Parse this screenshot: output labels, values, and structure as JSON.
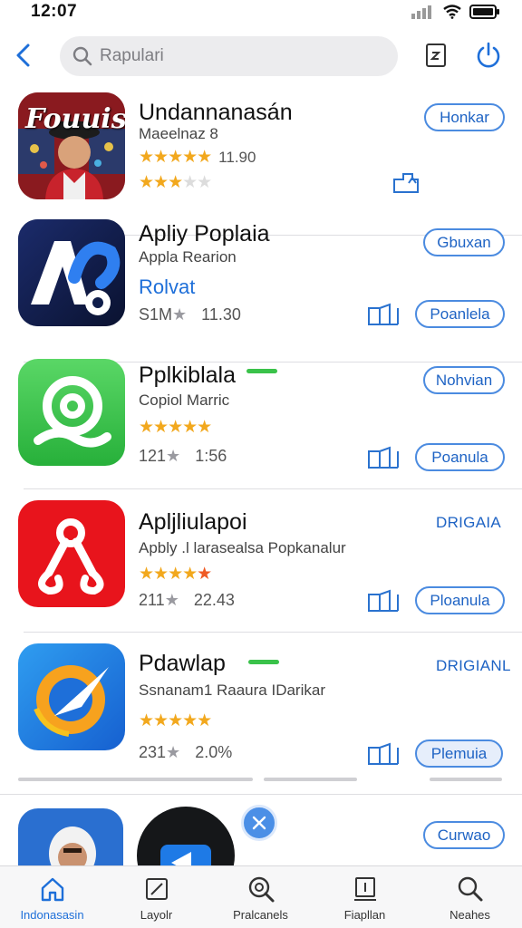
{
  "status": {
    "time": "12:07"
  },
  "search": {
    "placeholder": "Rapulari"
  },
  "apps": [
    {
      "icon_text": "Fouuis",
      "title": "Undannanasán",
      "subtitle": "Maeelnaz 8",
      "rating_top": "★★★★★",
      "rating_top_value": "11.90",
      "rating_bottom": "★★★",
      "rating_bottom_dim": "★★",
      "button": "Honkar"
    },
    {
      "icon_text": "AP",
      "title": "Apliy Poplaia",
      "subtitle": "Appla Rearion",
      "link": "Rolvat",
      "meta_left": "S1M",
      "meta_right": "11.30",
      "button": "Gbuxan",
      "action": "Poanlela"
    },
    {
      "title": "Pplkiblala",
      "subtitle": "Copiol Marric",
      "rating": "★★★★★",
      "meta_left": "121",
      "meta_right": "1:56",
      "button": "Nohvian",
      "action": "Poanula"
    },
    {
      "title": "Apljliulapoi",
      "subtitle": "Apbly .l larasealsa Popkanalur",
      "rating": "★★★★",
      "rating_red": "★",
      "meta_left": "211",
      "meta_right": "22.43",
      "button": "DRIGAIA",
      "action": "Ploanula"
    },
    {
      "title": "Pdawlap",
      "subtitle": "Ssnanam1 Raaura IDarikar",
      "rating": "★★★★★",
      "meta_left": "231",
      "meta_right": "2.0%",
      "button": "DRIGIANL",
      "action": "Plemuia"
    },
    {
      "button": "Curwao"
    }
  ],
  "tabs": [
    {
      "label": "Indonasasin"
    },
    {
      "label": "Layolr"
    },
    {
      "label": "Pralcanels"
    },
    {
      "label": "Fiapllan"
    },
    {
      "label": "Neahes"
    }
  ],
  "colors": {
    "accent": "#1e6fd9",
    "star": "#f2a81d"
  }
}
